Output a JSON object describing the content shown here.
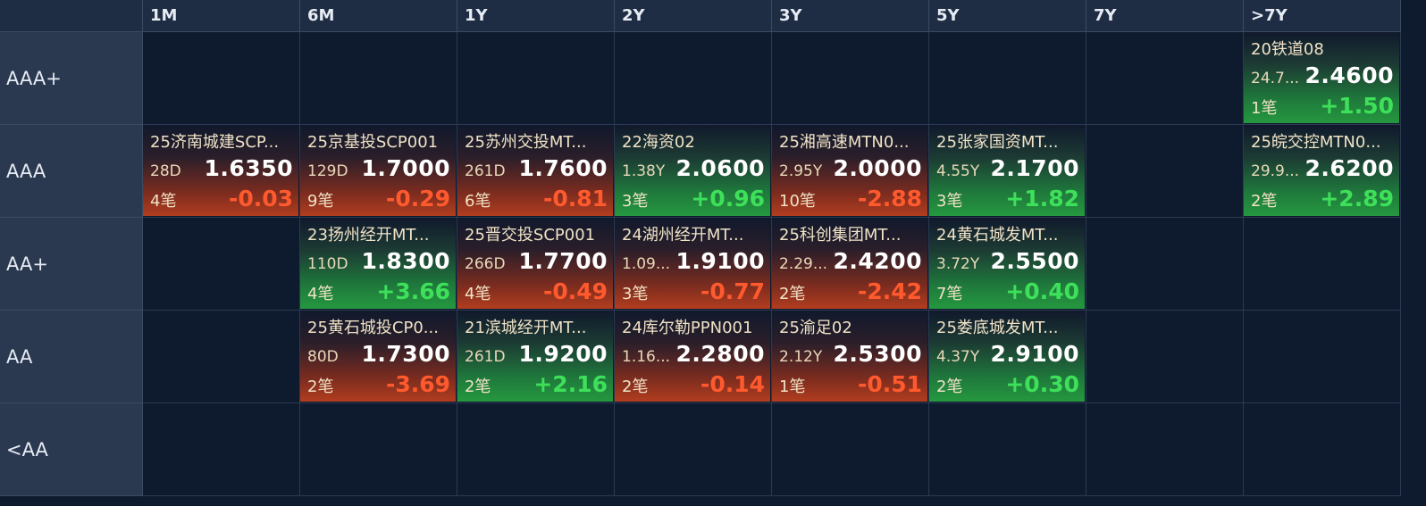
{
  "columns": [
    "1M",
    "6M",
    "1Y",
    "2Y",
    "3Y",
    "5Y",
    "7Y",
    ">7Y"
  ],
  "rows": [
    "AAA+",
    "AAA",
    "AA+",
    "AA",
    "<AA"
  ],
  "cells": [
    {
      "row": 0,
      "col": 7,
      "name": "20铁道08",
      "term": "24.7...",
      "price": "2.4600",
      "count": "1笔",
      "change": "+1.50",
      "direction": "up"
    },
    {
      "row": 1,
      "col": 0,
      "name": "25济南城建SCP...",
      "term": "28D",
      "price": "1.6350",
      "count": "4笔",
      "change": "-0.03",
      "direction": "down"
    },
    {
      "row": 1,
      "col": 1,
      "name": "25京基投SCP001",
      "term": "129D",
      "price": "1.7000",
      "count": "9笔",
      "change": "-0.29",
      "direction": "down"
    },
    {
      "row": 1,
      "col": 2,
      "name": "25苏州交投MT...",
      "term": "261D",
      "price": "1.7600",
      "count": "6笔",
      "change": "-0.81",
      "direction": "down"
    },
    {
      "row": 1,
      "col": 3,
      "name": "22海资02",
      "term": "1.38Y",
      "price": "2.0600",
      "count": "3笔",
      "change": "+0.96",
      "direction": "up"
    },
    {
      "row": 1,
      "col": 4,
      "name": "25湘高速MTN0...",
      "term": "2.95Y",
      "price": "2.0000",
      "count": "10笔",
      "change": "-2.88",
      "direction": "down"
    },
    {
      "row": 1,
      "col": 5,
      "name": "25张家国资MT...",
      "term": "4.55Y",
      "price": "2.1700",
      "count": "3笔",
      "change": "+1.82",
      "direction": "up"
    },
    {
      "row": 1,
      "col": 7,
      "name": "25皖交控MTN0...",
      "term": "29.9...",
      "price": "2.6200",
      "count": "2笔",
      "change": "+2.89",
      "direction": "up"
    },
    {
      "row": 2,
      "col": 1,
      "name": "23扬州经开MT...",
      "term": "110D",
      "price": "1.8300",
      "count": "4笔",
      "change": "+3.66",
      "direction": "up"
    },
    {
      "row": 2,
      "col": 2,
      "name": "25晋交投SCP001",
      "term": "266D",
      "price": "1.7700",
      "count": "4笔",
      "change": "-0.49",
      "direction": "down"
    },
    {
      "row": 2,
      "col": 3,
      "name": "24湖州经开MT...",
      "term": "1.09...",
      "price": "1.9100",
      "count": "3笔",
      "change": "-0.77",
      "direction": "down"
    },
    {
      "row": 2,
      "col": 4,
      "name": "25科创集团MT...",
      "term": "2.29...",
      "price": "2.4200",
      "count": "2笔",
      "change": "-2.42",
      "direction": "down"
    },
    {
      "row": 2,
      "col": 5,
      "name": "24黄石城发MT...",
      "term": "3.72Y",
      "price": "2.5500",
      "count": "7笔",
      "change": "+0.40",
      "direction": "up"
    },
    {
      "row": 3,
      "col": 1,
      "name": "25黄石城投CP0...",
      "term": "80D",
      "price": "1.7300",
      "count": "2笔",
      "change": "-3.69",
      "direction": "down"
    },
    {
      "row": 3,
      "col": 2,
      "name": "21滨城经开MT...",
      "term": "261D",
      "price": "1.9200",
      "count": "2笔",
      "change": "+2.16",
      "direction": "up"
    },
    {
      "row": 3,
      "col": 3,
      "name": "24库尔勒PPN001",
      "term": "1.16...",
      "price": "2.2800",
      "count": "2笔",
      "change": "-0.14",
      "direction": "down"
    },
    {
      "row": 3,
      "col": 4,
      "name": "25渝足02",
      "term": "2.12Y",
      "price": "2.5300",
      "count": "1笔",
      "change": "-0.51",
      "direction": "down"
    },
    {
      "row": 3,
      "col": 5,
      "name": "25娄底城发MT...",
      "term": "4.37Y",
      "price": "2.9100",
      "count": "2笔",
      "change": "+0.30",
      "direction": "up"
    }
  ]
}
